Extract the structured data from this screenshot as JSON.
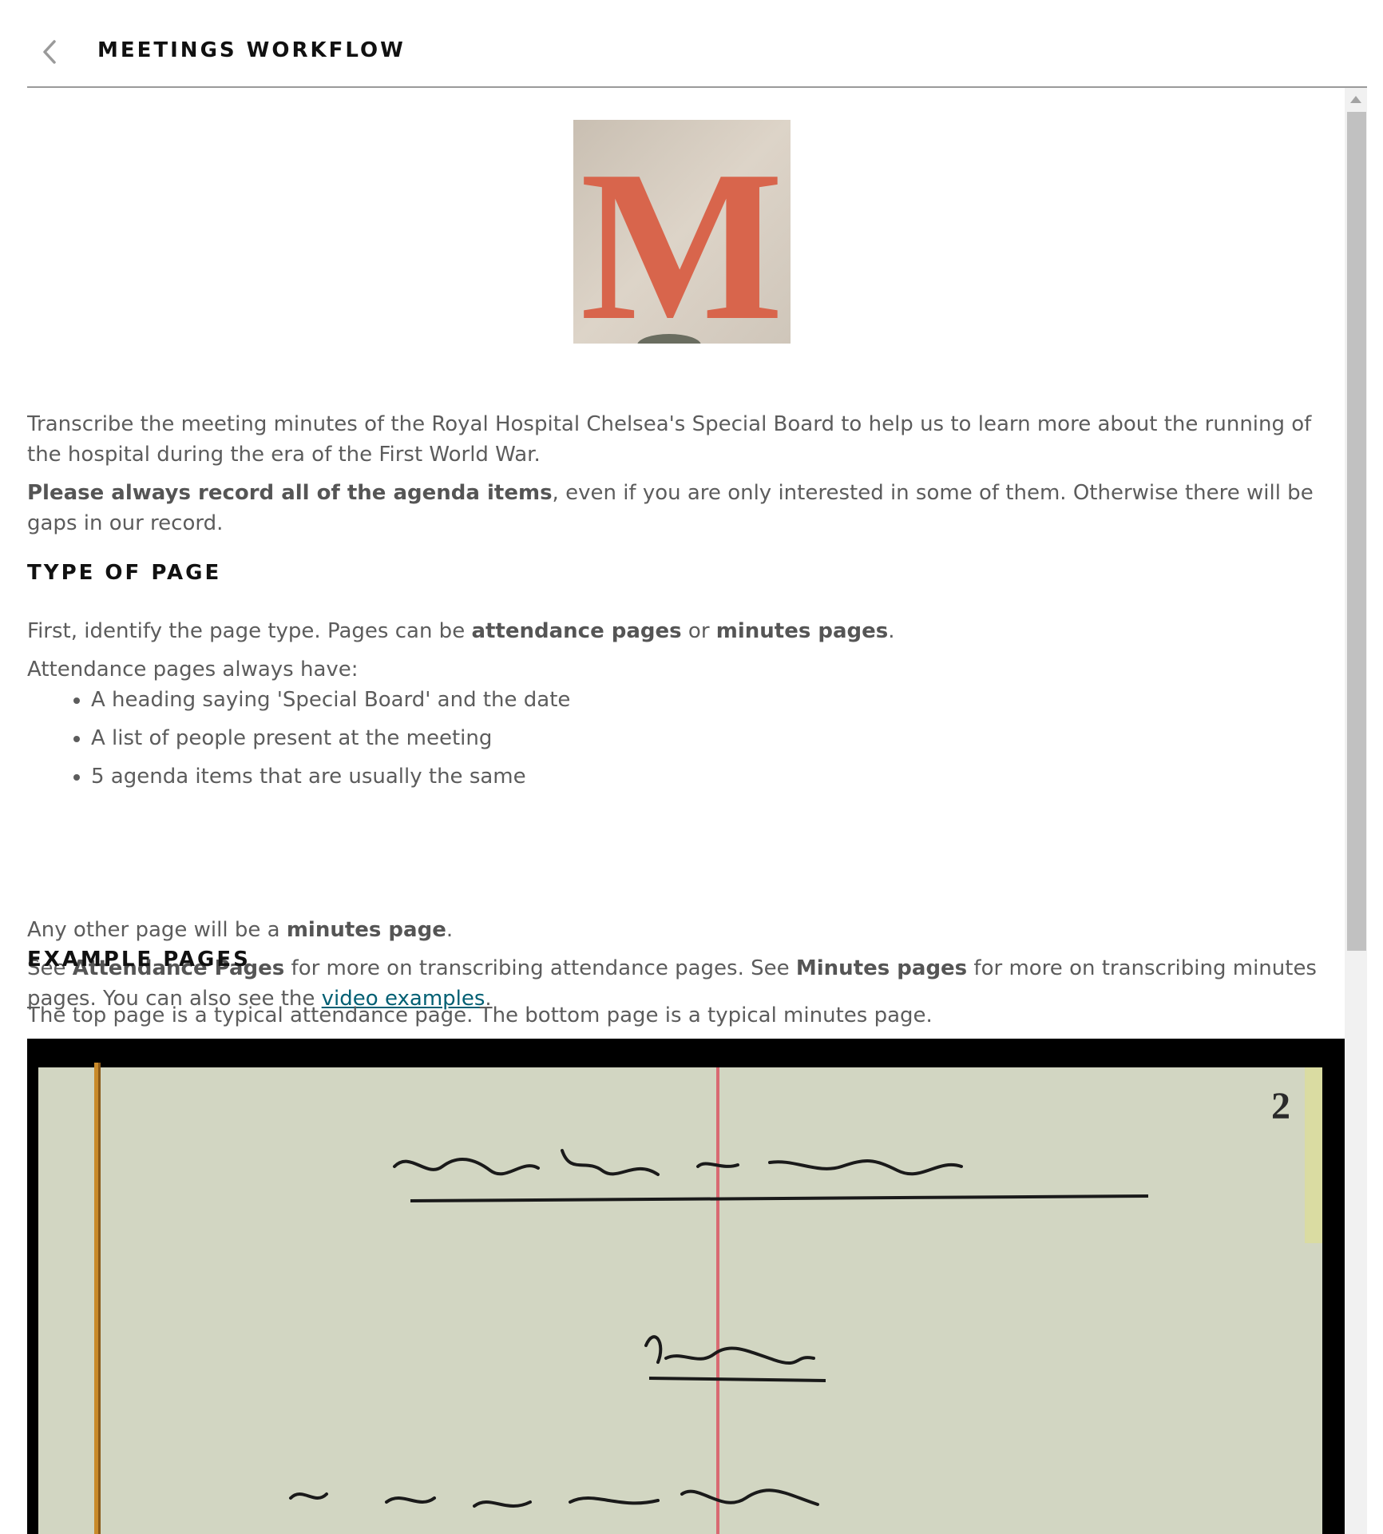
{
  "header": {
    "title": "MEETINGS WORKFLOW",
    "back_icon": "chevron-left-icon"
  },
  "intro": {
    "p1": "Transcribe the meeting minutes of the Royal Hospital Chelsea's Special Board to help us to learn more about the running of the hospital during the era of the First World War.",
    "p2_bold": "Please always record all of the agenda items",
    "p2_rest": ", even if you are only interested in some of them. Otherwise there will be gaps in our record."
  },
  "type_of_page": {
    "heading": "TYPE OF PAGE",
    "p1_pre": "First, identify the page type. Pages can be ",
    "p1_b1": "attendance pages",
    "p1_mid": " or ",
    "p1_b2": "minutes pages",
    "p1_end": ".",
    "p2": "Attendance pages always have:",
    "bullets": [
      "A heading saying 'Special Board' and the date",
      "A list of people present at the meeting",
      "5 agenda items that are usually the same"
    ],
    "p3_pre": "Any other page will be a ",
    "p3_b": "minutes page",
    "p3_end": ".",
    "p4_pre": "See ",
    "p4_b1": "Attendance Pages",
    "p4_mid1": " for more on transcribing attendance pages. See ",
    "p4_b2": "Minutes pages",
    "p4_mid2": " for more on transcribing minutes pages. You can also see the ",
    "p4_link": "video examples",
    "p4_end": "."
  },
  "example_pages": {
    "heading": "EXAMPLE PAGES",
    "p1": "The top page is a typical attendance page. The bottom page is a typical minutes page.",
    "page_number": "2"
  },
  "logo": {
    "letter": "M"
  },
  "colors": {
    "link": "#005f73",
    "logo_letter": "#d8654c",
    "paper": "#d2d6c2"
  }
}
